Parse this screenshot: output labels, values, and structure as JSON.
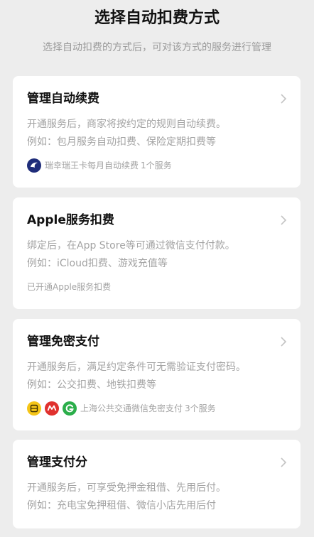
{
  "header": {
    "title": "选择自动扣费方式",
    "subtitle": "选择自动扣费的方式后，可对该方式的服务进行管理"
  },
  "cards": [
    {
      "title": "管理自动续费",
      "desc1": "开通服务后，商家将按约定的规则自动续费。",
      "desc2": "例如：包月服务自动扣费、保险定期扣费等",
      "footer_name": "瑞幸瑞王卡每月自动续费",
      "footer_count": "1个服务",
      "icons": [
        "luckin-coffee-icon"
      ]
    },
    {
      "title": "Apple服务扣费",
      "desc1": "绑定后，在App Store等可通过微信支付付款。",
      "desc2": "例如：iCloud扣费、游戏充值等",
      "footer_name": "已开通Apple服务扣费"
    },
    {
      "title": "管理免密支付",
      "desc1": "开通服务后，满足约定条件可无需验证支付密码。",
      "desc2": "例如：公交扣费、地铁扣费等",
      "footer_name": "上海公共交通微信免密支付",
      "footer_count": "3个服务",
      "icons": [
        "transit-card-icon",
        "metro-icon",
        "green-bus-icon"
      ]
    },
    {
      "title": "管理支付分",
      "desc1": "开通服务后，可享受免押金租借、先用后付。",
      "desc2": "例如：充电宝免押租借、微信小店先用后付"
    }
  ],
  "colors": {
    "background": "#EDEDED",
    "card": "#FFFFFF",
    "title_text": "#111111",
    "secondary_text": "#A3A3A3",
    "luckin_blue": "#1F2D7A",
    "transit_yellow": "#F5C518",
    "metro_red": "#E0312E",
    "bus_green": "#2BAE4A"
  }
}
